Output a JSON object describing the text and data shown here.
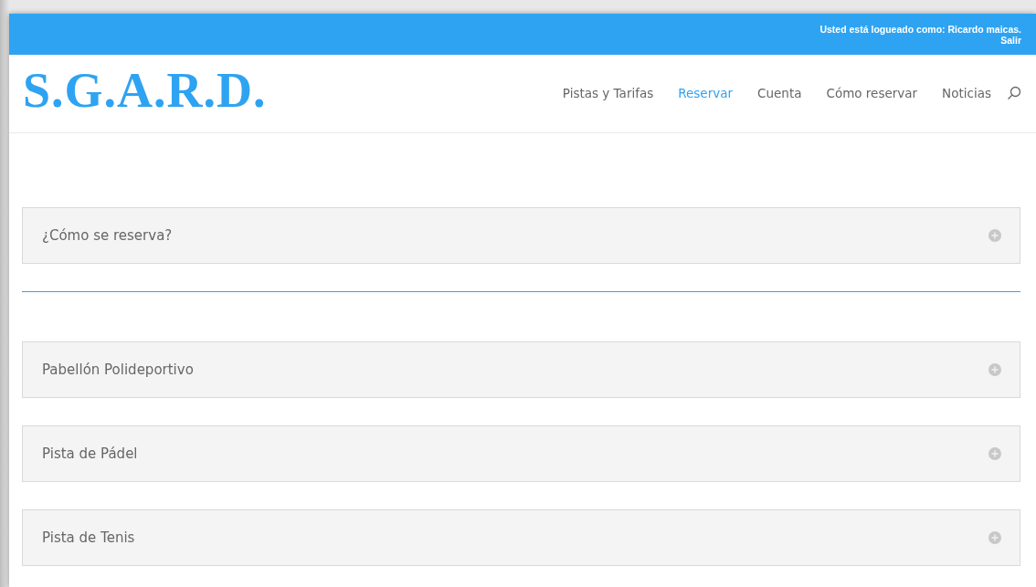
{
  "top_bar": {
    "login_text": "Usted está logueado como: Ricardo maicas.",
    "logout_link": "Salir"
  },
  "header": {
    "logo": "S.G.A.R.D.",
    "nav": [
      {
        "label": "Pistas y Tarifas",
        "selected": false
      },
      {
        "label": "Reservar",
        "selected": true
      },
      {
        "label": "Cuenta",
        "selected": false
      },
      {
        "label": "Cómo reservar",
        "selected": false
      },
      {
        "label": "Noticias",
        "selected": false
      }
    ]
  },
  "sections": [
    {
      "toggles": [
        {
          "title": "¿Cómo se reserva?"
        }
      ]
    },
    {
      "toggles": [
        {
          "title": "Pabellón Polideportivo"
        },
        {
          "title": "Pista de Pádel"
        },
        {
          "title": "Pista de Tenis"
        }
      ]
    }
  ]
}
